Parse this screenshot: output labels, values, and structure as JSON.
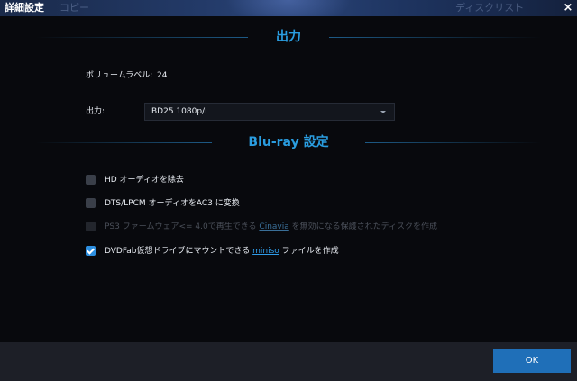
{
  "window": {
    "title": "詳細設定",
    "close_label": "×",
    "background_tabs": [
      "コピー",
      "ディスクリスト"
    ]
  },
  "output_section": {
    "title": "出力",
    "volume_label_label": "ボリュームラベル:",
    "volume_label_value": "24",
    "output_label": "出力:",
    "output_selected": "BD25 1080p/i"
  },
  "bluray_section": {
    "title": "Blu-ray 設定",
    "options": [
      {
        "label": "HD オーディオを除去",
        "checked": false,
        "disabled": false
      },
      {
        "label": "DTS/LPCM オーディオをAC3 に変換",
        "checked": false,
        "disabled": false
      },
      {
        "label_before": "PS3 ファームウェア<= 4.0で再生できる ",
        "link": "Cinavia",
        "label_after": " を無効になる保護されたディスクを作成",
        "checked": false,
        "disabled": true
      },
      {
        "label_before": "DVDFab仮想ドライブにマウントできる ",
        "link": "miniso",
        "label_after": " ファイルを作成",
        "checked": true,
        "disabled": false
      }
    ]
  },
  "footer": {
    "ok_label": "OK"
  },
  "colors": {
    "accent": "#2a9de0",
    "button": "#1f6fb8",
    "background": "#08090d",
    "footer": "#1d1f27"
  }
}
